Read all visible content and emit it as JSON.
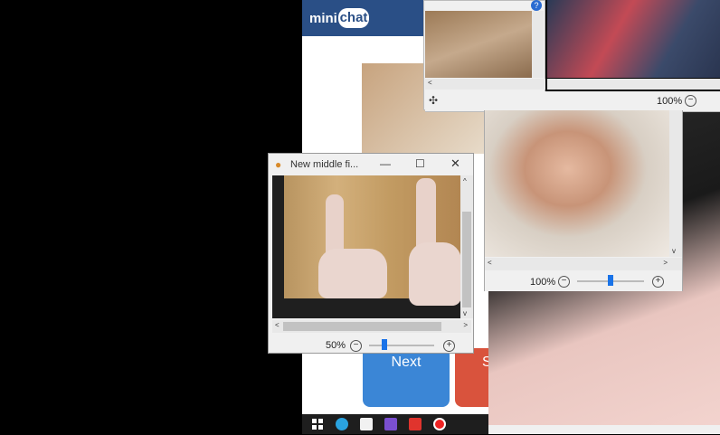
{
  "minichat": {
    "logo_mini": "mini",
    "logo_chat": "chat",
    "next_label": "Next",
    "stop_label": "S"
  },
  "front_window": {
    "title": "New middle fi...",
    "minimize_glyph": "—",
    "maximize_glyph": "☐",
    "close_glyph": "✕",
    "zoom": "50%",
    "zoom_level": 0.25
  },
  "middle_window": {
    "zoom": "100%",
    "zoom_level": 0.5
  },
  "top_window": {
    "zoom": "100%",
    "help_glyph": "?"
  },
  "glyphs": {
    "minus": "−",
    "plus": "+",
    "pan": "✣",
    "left": "<",
    "right": ">",
    "up": "^",
    "down": "v"
  },
  "taskbar": {
    "icons": [
      "windows-start-icon",
      "telegram-icon",
      "store-icon",
      "film-icon",
      "vivaldi-icon",
      "record-icon"
    ]
  },
  "colors": {
    "minichat_blue": "#2a4f86",
    "next_button": "#3b86d6",
    "stop_button": "#d9533d",
    "slider_thumb": "#1a73e8"
  }
}
